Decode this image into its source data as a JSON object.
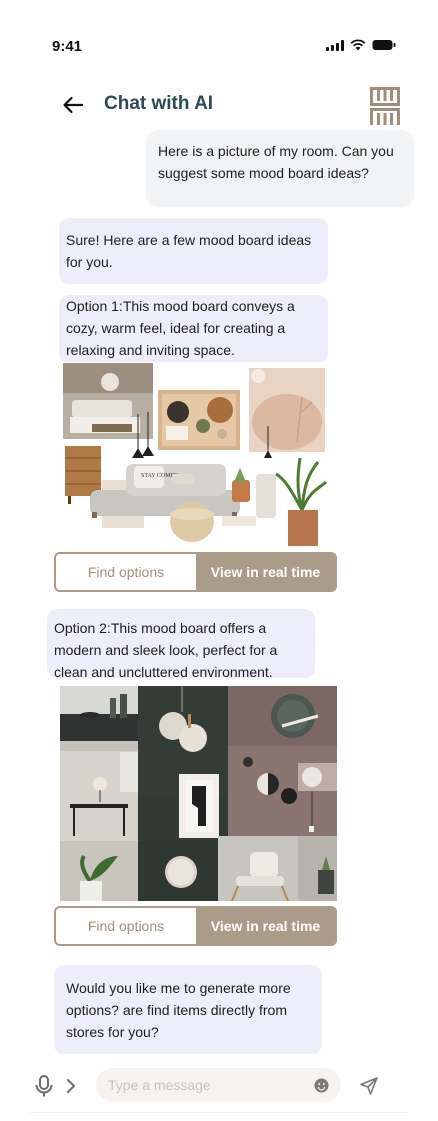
{
  "status_bar": {
    "time": "9:41"
  },
  "header": {
    "title": "Chat with AI",
    "back_icon": "arrow-left-icon",
    "logo_icon": "brand-logo-icon"
  },
  "messages": [
    {
      "role": "user",
      "text": "Here is a picture of my room. Can you suggest some mood board ideas?"
    },
    {
      "role": "ai",
      "text": "Sure! Here are a few mood board ideas for you."
    },
    {
      "role": "ai",
      "text": "Option 1:This mood board conveys a cozy, warm feel, ideal for creating a relaxing and inviting space."
    },
    {
      "role": "ai",
      "text": "Option 2:This mood board offers a modern and sleek look, perfect for a clean and uncluttered environment."
    },
    {
      "role": "ai",
      "text": "Would you like me to generate more options? are find items directly from stores for you?"
    }
  ],
  "moodboard_1": {
    "sign_text": "STAY COMFY"
  },
  "option_1_actions": {
    "find_label": "Find options",
    "view_label": "View in real time"
  },
  "option_2_actions": {
    "find_label": "Find options",
    "view_label": "View in real time"
  },
  "composer": {
    "placeholder": "Type a message",
    "mic_icon": "microphone-icon",
    "expand_icon": "chevron-right-icon",
    "emoji_icon": "emoji-icon",
    "send_icon": "send-icon"
  },
  "colors": {
    "title": "#2e4a55",
    "accent": "#ab9b89",
    "ai_bubble": "#eeeefb",
    "user_bubble": "#f2f3f5",
    "input_bg": "#f6f3ef"
  }
}
